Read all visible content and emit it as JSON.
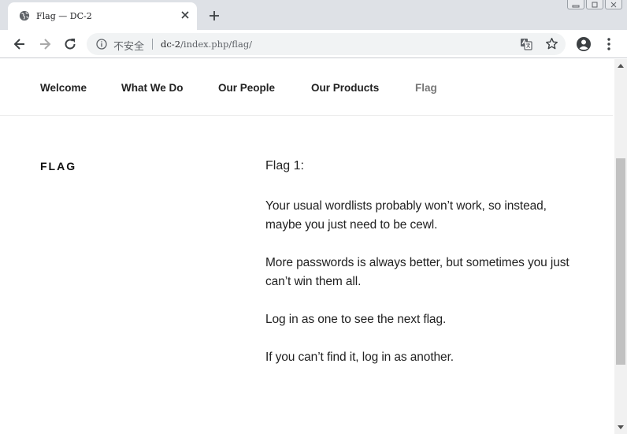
{
  "browser": {
    "tab_title": "Flag — DC-2",
    "security_label": "不安全",
    "url_host": "dc-2",
    "url_path": "/index.php/flag/"
  },
  "site_nav": {
    "items": [
      {
        "label": "Welcome"
      },
      {
        "label": "What We Do"
      },
      {
        "label": "Our People"
      },
      {
        "label": "Our Products"
      },
      {
        "label": "Flag",
        "active": true
      }
    ]
  },
  "page": {
    "heading": "FLAG",
    "flag_title": "Flag 1:",
    "paragraphs": [
      "Your usual wordlists probably won’t work, so instead, maybe you just need to be cewl.",
      "More passwords is always better, but sometimes you just can’t win them all.",
      "Log in as one to see the next flag.",
      "If you can’t find it, log in as another."
    ]
  },
  "scrollbar": {
    "position": 0.35
  },
  "icons": [
    "globe-icon",
    "close-icon",
    "plus-icon",
    "back-icon",
    "forward-icon",
    "reload-icon",
    "info-icon",
    "translate-icon",
    "star-icon",
    "profile-icon",
    "menu-icon"
  ],
  "colors": {
    "tab_strip": "#dee1e6",
    "omnibox": "#f1f3f4",
    "active_nav": "#777777",
    "text": "#222222"
  }
}
